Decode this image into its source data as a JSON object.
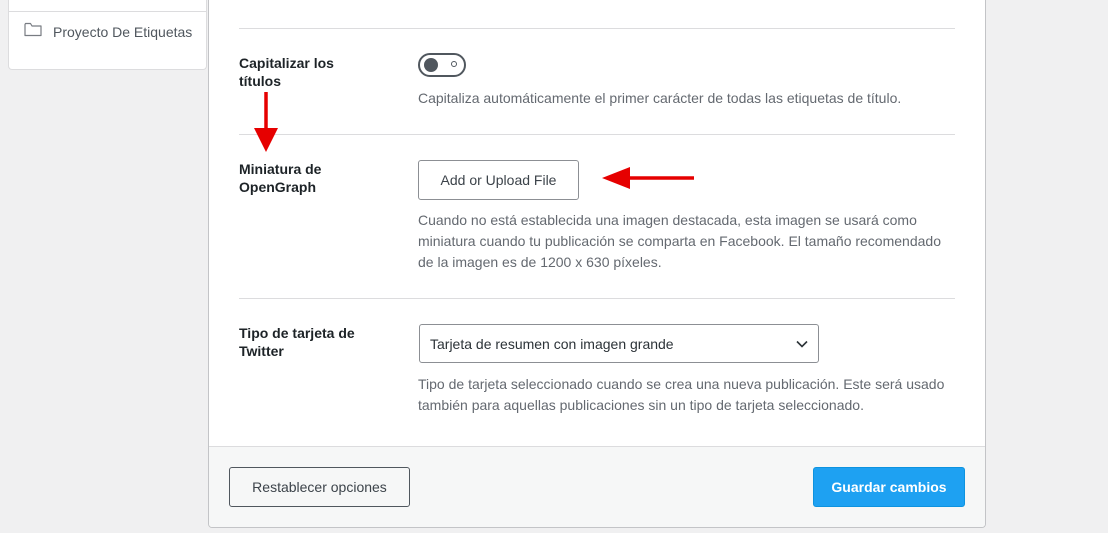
{
  "sidebar": {
    "folder_label": "Proyecto De Etiquetas",
    "folder_icon": "folder-icon"
  },
  "settings": {
    "capitalize": {
      "label": "Capitalizar los títulos",
      "enabled": false,
      "description": "Capitaliza automáticamente el primer carácter de todas las etiquetas de título."
    },
    "og_thumbnail": {
      "label": "Miniatura de OpenGraph",
      "button_label": "Add or Upload File",
      "description": "Cuando no está establecida una imagen destacada, esta imagen se usará como miniatura cuando tu publicación se comparta en Facebook. El tamaño recomendado de la imagen es de 1200 x 630 píxeles."
    },
    "twitter_card": {
      "label": "Tipo de tarjeta de Twitter",
      "selected": "Tarjeta de resumen con imagen grande",
      "description": "Tipo de tarjeta seleccionado cuando se crea una nueva publicación. Este será usado también para aquellas publicaciones sin un tipo de tarjeta seleccionado."
    }
  },
  "footer": {
    "reset_label": "Restablecer opciones",
    "save_label": "Guardar cambios"
  },
  "colors": {
    "accent": "#1ea1f2",
    "annotation": "#e60000"
  }
}
